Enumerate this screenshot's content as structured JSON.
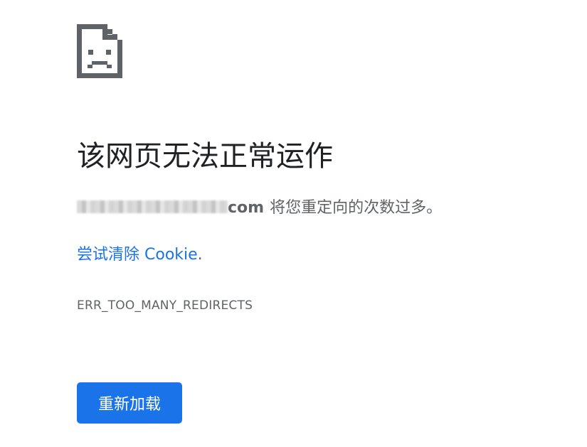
{
  "error_page": {
    "title": "该网页无法正常运作",
    "host_visible_suffix": "com",
    "description": "将您重定向的次数过多。",
    "link_text": "尝试清除 Cookie",
    "link_suffix": ".",
    "error_code": "ERR_TOO_MANY_REDIRECTS",
    "reload_label": "重新加载"
  },
  "colors": {
    "accent": "#1a73e8",
    "title": "#202124",
    "body_text": "#5f6368",
    "icon": "#5f6368"
  },
  "icons": {
    "error_icon": "sad-page-icon"
  }
}
